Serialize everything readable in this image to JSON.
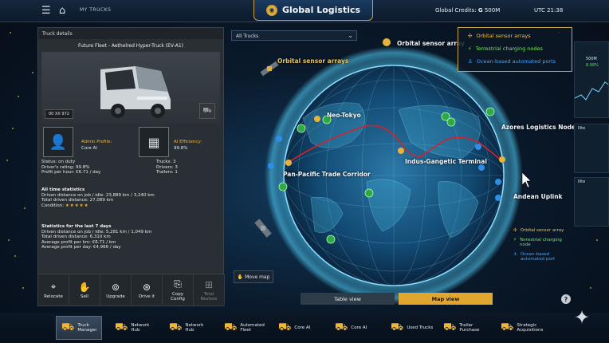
{
  "topbar": {
    "breadcrumb": "MY TRUCKS",
    "title": "Global Logistics",
    "credits_label": "Global Credits:",
    "credits_icon": "G",
    "credits_value": "500M",
    "time": "UTC 21:38"
  },
  "truck_panel": {
    "header": "Truck details",
    "name": "Future Fleet - Aethelred Hyper-Truck (EV-A1)",
    "plate": "00 XX 972",
    "driver_profile_label": "Admin Profile:",
    "driver_profile_value": "Core AI",
    "status_line": "Status: on duty",
    "rating_line": "Driver's rating: 99.8%",
    "profit_line": "Profit per hour: €6.71 / day",
    "ai_efficiency_label": "AI Efficiency:",
    "ai_efficiency_value": "99.8%",
    "trucks_line": "Trucks: 3",
    "drivers_line": "Drivers: 3",
    "trailers_line": "Trailers: 1",
    "all_time_header": "All time statistics",
    "all_time_driven": "Driven distance on job / idle: 23,889 km / 3,240 km",
    "all_time_total": "Total driven distance: 27,089 km",
    "condition_label": "Condition:",
    "condition_stars": "★★★★★",
    "week_header": "Statistics for the last 7 days",
    "week_driven": "Driven distance on job / idle: 5,281 km / 1,049 km",
    "week_total": "Total driven distance: 6,310 km",
    "week_avg_km": "Average profit per km: €6.71 / km",
    "week_avg_day": "Average profit per day: €4,966 / day",
    "actions": [
      {
        "label": "Relocate",
        "icon": "location-pin-icon",
        "glyph": "⌖"
      },
      {
        "label": "Sell",
        "icon": "hand-icon",
        "glyph": "✋"
      },
      {
        "label": "Upgrade",
        "icon": "upgrade-icon",
        "glyph": "⊚"
      },
      {
        "label": "Drive it",
        "icon": "steering-wheel-icon",
        "glyph": "⊛"
      },
      {
        "label": "Copy\nConfig",
        "icon": "copy-icon",
        "glyph": "⎘"
      },
      {
        "label": "Total\nRestore",
        "icon": "restore-icon",
        "glyph": "⊞"
      }
    ]
  },
  "map": {
    "filter_value": "All Trucks",
    "labels": {
      "orbital_1": "Orbital sensor arrays",
      "orbital_2": "Orbital sensor array",
      "neo_tokyo": "Neo-Tokyo",
      "azores": "Azores Logistics Node",
      "indus": "Indus-Gangetic Terminal",
      "pan_pacific": "Pan-Pacific Trade Corridor",
      "andean": "Andean Uplink"
    },
    "legend_top": [
      "Orbital sensor arrays",
      "Terrestrial charging nodes",
      "Ocean-based automated ports"
    ],
    "legend_bottom": [
      "Orbital sensor array",
      "Terrestrial charging node",
      "Ocean-based automated port"
    ],
    "move_map": "Move map",
    "table_view": "Table view",
    "map_view": "Map view",
    "help": "?",
    "route_color": "#d8202a",
    "accent_gold": "#e2b23c"
  },
  "thumbs": {
    "t1_value": "500M",
    "t1_change": "8.98%",
    "t2_label": "llite",
    "t3_label": "llite"
  },
  "bottom_nav": [
    {
      "label": "Truck\nManager",
      "icon": "truck-manager-icon"
    },
    {
      "label": "Network\nHub",
      "icon": "network-hub-icon"
    },
    {
      "label": "Network\nHub",
      "icon": "network-hub-icon"
    },
    {
      "label": "Automated\nFleet",
      "icon": "automated-fleet-icon"
    },
    {
      "label": "Core AI",
      "icon": "core-ai-icon"
    },
    {
      "label": "Core AI",
      "icon": "core-ai-icon"
    },
    {
      "label": "Used Trucks",
      "icon": "used-trucks-icon"
    },
    {
      "label": "Trailer\nPurchase",
      "icon": "trailer-icon"
    },
    {
      "label": "Strategic\nAcquisitions",
      "icon": "acquisitions-icon"
    }
  ]
}
